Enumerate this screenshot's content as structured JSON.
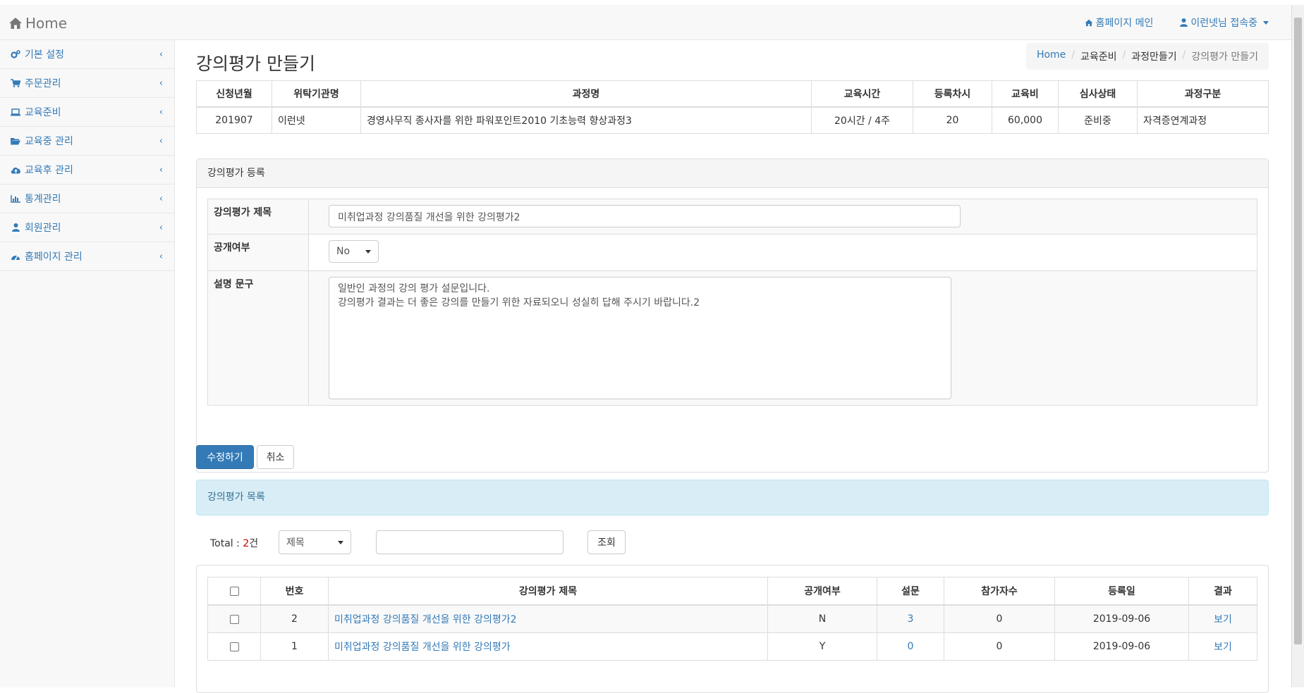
{
  "navbar": {
    "brand": "Home",
    "homepage_link": "홈페이지 메인",
    "user_menu": "이런넷님 접속중"
  },
  "sidebar": {
    "items": [
      {
        "label": "기본 설정",
        "icon": "gears-icon"
      },
      {
        "label": "주문관리",
        "icon": "cart-icon"
      },
      {
        "label": "교육준비",
        "icon": "laptop-icon"
      },
      {
        "label": "교육중 관리",
        "icon": "folder-open-icon"
      },
      {
        "label": "교육후 관리",
        "icon": "cloud-upload-icon"
      },
      {
        "label": "통계관리",
        "icon": "bar-chart-icon"
      },
      {
        "label": "회원관리",
        "icon": "user-icon"
      },
      {
        "label": "홈페이지 관리",
        "icon": "dashboard-icon"
      }
    ]
  },
  "page": {
    "title": "강의평가 만들기",
    "breadcrumb": [
      "Home",
      "교육준비",
      "과정만들기",
      "강의평가 만들기"
    ]
  },
  "course_info": {
    "headers": [
      "신청년월",
      "위탁기관명",
      "과정명",
      "교육시간",
      "등록차시",
      "교육비",
      "심사상태",
      "과정구분"
    ],
    "row": [
      "201907",
      "이런넷",
      "경영사무직 종사자를 위한 파워포인트2010 기초능력 향상과정3",
      "20시간 / 4주",
      "20",
      "60,000",
      "준비중",
      "자격증연계과정"
    ]
  },
  "form": {
    "panel_title": "강의평가 등록",
    "title_label": "강의평가 제목",
    "title_value": "미취업과정 강의품질 개선을 위한 강의평가2",
    "public_label": "공개여부",
    "public_value": "No",
    "desc_label": "설명 문구",
    "desc_value": "일반인 과정의 강의 평가 설문입니다.\n강의평가 결과는 더 좋은 강의를 만들기 위한 자료되오니 성실히 답해 주시기 바랍니다.2"
  },
  "buttons": {
    "save": "수정하기",
    "cancel": "취소"
  },
  "list": {
    "title": "강의평가 목록",
    "total_label": "Total : ",
    "total_count": "2",
    "total_unit": "건",
    "search_field": "제목",
    "search_value": "",
    "search_button": "조회",
    "headers": [
      "번호",
      "강의평가 제목",
      "공개여부",
      "설문",
      "참가자수",
      "등록일",
      "결과"
    ],
    "rows": [
      {
        "no": "2",
        "title": "미취업과정 강의품질 개선을 위한 강의평가2",
        "public": "N",
        "survey": "3",
        "participants": "0",
        "date": "2019-09-06",
        "result": "보기"
      },
      {
        "no": "1",
        "title": "미취업과정 강의품질 개선을 위한 강의평가",
        "public": "Y",
        "survey": "0",
        "participants": "0",
        "date": "2019-09-06",
        "result": "보기"
      }
    ]
  },
  "colors": {
    "link": "#337ab7",
    "primary": "#337ab7",
    "info_bg": "#d9edf7",
    "info_text": "#31708f"
  }
}
